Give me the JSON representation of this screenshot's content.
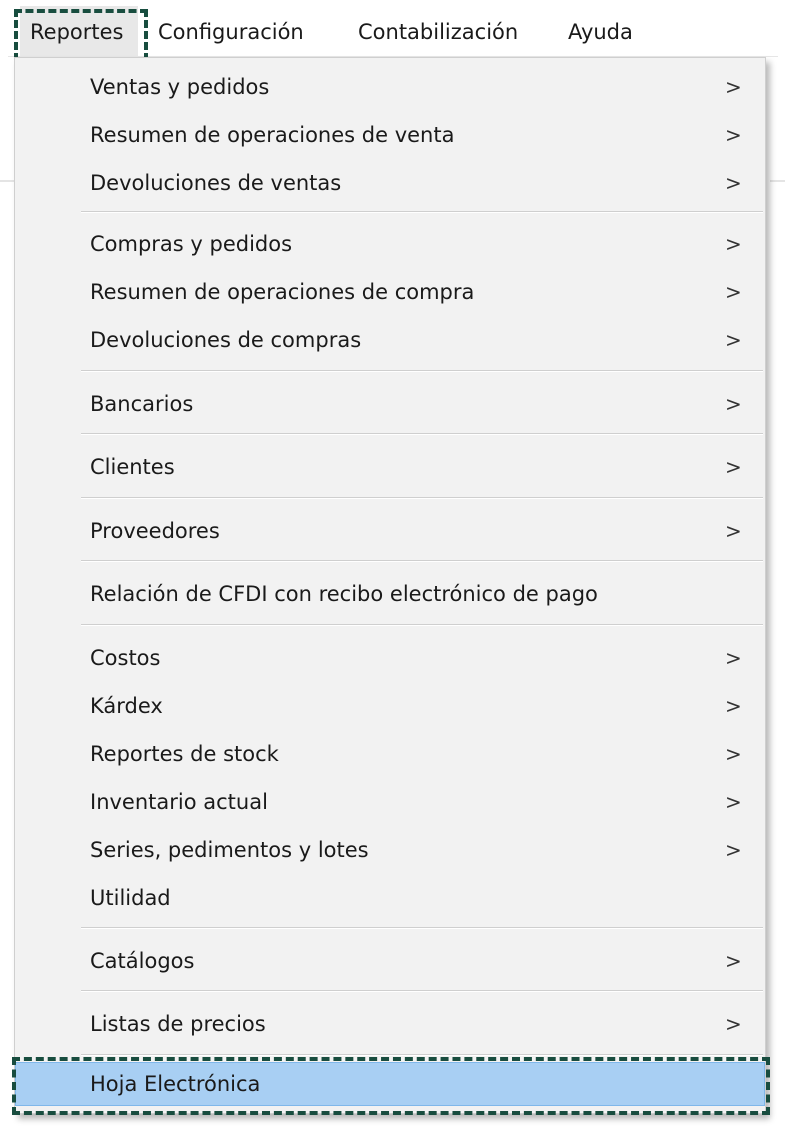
{
  "menubar": {
    "items": [
      {
        "label": "Reportes"
      },
      {
        "label": "Configuración"
      },
      {
        "label": "Contabilización"
      },
      {
        "label": "Ayuda"
      }
    ]
  },
  "dropdown": {
    "submenu_arrow": ">",
    "items": [
      {
        "label": "Ventas y pedidos"
      },
      {
        "label": "Resumen de operaciones de venta"
      },
      {
        "label": "Devoluciones de ventas"
      },
      {
        "label": "Compras y pedidos"
      },
      {
        "label": "Resumen de operaciones de compra"
      },
      {
        "label": "Devoluciones de compras"
      },
      {
        "label": "Bancarios"
      },
      {
        "label": "Clientes"
      },
      {
        "label": "Proveedores"
      },
      {
        "label": "Relación de CFDI con recibo electrónico de pago"
      },
      {
        "label": "Costos"
      },
      {
        "label": "Kárdex"
      },
      {
        "label": "Reportes de stock"
      },
      {
        "label": "Inventario actual"
      },
      {
        "label": "Series, pedimentos y lotes"
      },
      {
        "label": "Utilidad"
      },
      {
        "label": "Catálogos"
      },
      {
        "label": "Listas de precios"
      },
      {
        "label": "Hoja Electrónica"
      }
    ]
  },
  "colors": {
    "highlight": "#a8cff3",
    "focus_dashed_border": "#184d3f",
    "menu_background": "#f2f2f2"
  }
}
